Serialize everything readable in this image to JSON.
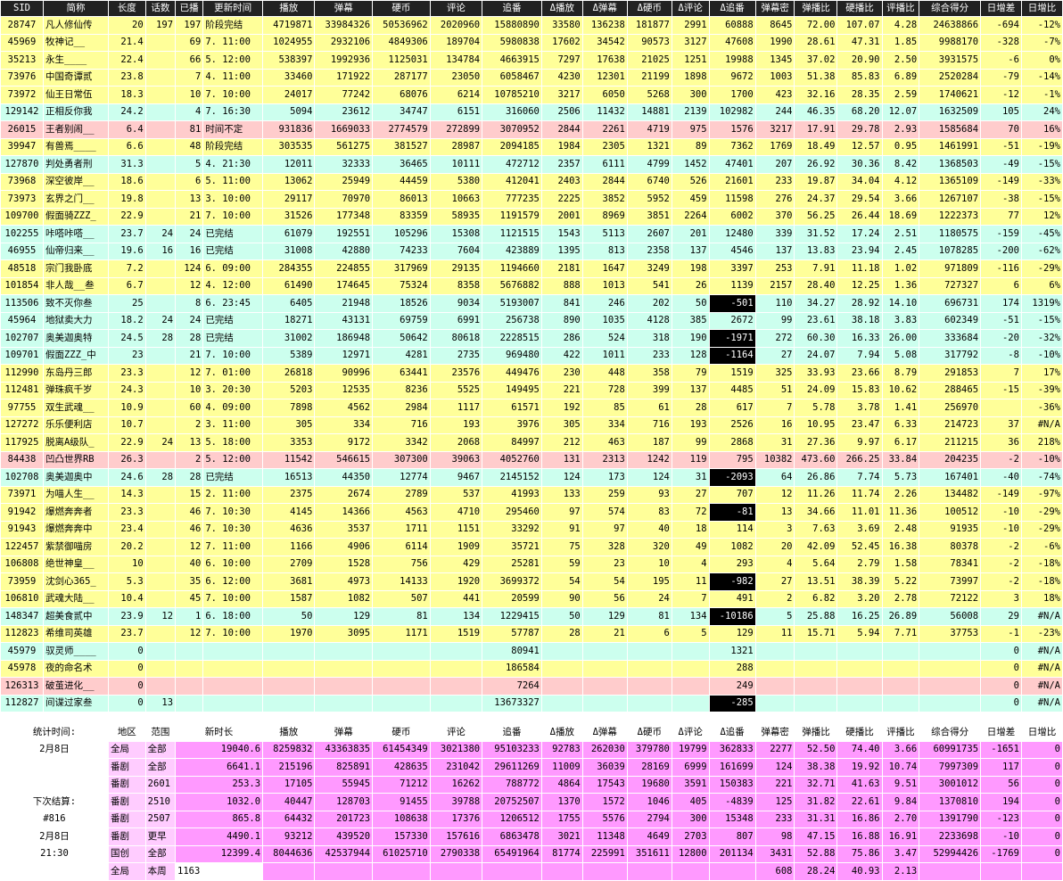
{
  "headers": [
    "SID",
    "简称",
    "长度",
    "话数",
    "已播",
    "更新时间",
    "播放",
    "弹幕",
    "硬币",
    "评论",
    "追番",
    "Δ播放",
    "Δ弹幕",
    "Δ硬币",
    "Δ评论",
    "Δ追番",
    "弹幕密",
    "弹播比",
    "硬播比",
    "评播比",
    "综合得分",
    "日增差",
    "日增比"
  ],
  "rows": [
    {
      "c": "yellow",
      "v": [
        "28747",
        "凡人修仙传",
        "20",
        "197",
        "197",
        "阶段完结",
        "4719871",
        "33984326",
        "50536962",
        "2020960",
        "15880890",
        "33580",
        "136238",
        "181877",
        "2991",
        "60888",
        "8645",
        "72.00",
        "107.07",
        "4.28",
        "24638866",
        "-694",
        "-12%"
      ]
    },
    {
      "c": "yellow",
      "v": [
        "45969",
        "牧神记__",
        "21.4",
        "",
        "69",
        "7. 11:00",
        "1024955",
        "2932106",
        "4849306",
        "189704",
        "5980838",
        "17602",
        "34542",
        "90573",
        "3127",
        "47608",
        "1990",
        "28.61",
        "47.31",
        "1.85",
        "9988170",
        "-328",
        "-7%"
      ]
    },
    {
      "c": "yellow",
      "v": [
        "35213",
        "永生____",
        "22.4",
        "",
        "66",
        "5. 12:00",
        "538397",
        "1992936",
        "1125031",
        "134784",
        "4663915",
        "7297",
        "17638",
        "21025",
        "1251",
        "19988",
        "1345",
        "37.02",
        "20.90",
        "2.50",
        "3931575",
        "-6",
        "0%"
      ]
    },
    {
      "c": "yellow",
      "v": [
        "73976",
        "中国奇谭贰",
        "23.8",
        "",
        "7",
        "4. 11:00",
        "33460",
        "171922",
        "287177",
        "23050",
        "6058467",
        "4230",
        "12301",
        "21199",
        "1898",
        "9672",
        "1003",
        "51.38",
        "85.83",
        "6.89",
        "2520284",
        "-79",
        "-14%"
      ]
    },
    {
      "c": "yellow",
      "v": [
        "73972",
        "仙王日常伍",
        "18.3",
        "",
        "10",
        "7. 10:00",
        "24017",
        "77242",
        "68076",
        "6214",
        "10785210",
        "3217",
        "6050",
        "5268",
        "300",
        "1700",
        "423",
        "32.16",
        "28.35",
        "2.59",
        "1740621",
        "-12",
        "-1%"
      ]
    },
    {
      "c": "cyan",
      "v": [
        "129142",
        "正相反你我",
        "24.2",
        "",
        "4",
        "7. 16:30",
        "5094",
        "23612",
        "34747",
        "6151",
        "316060",
        "2506",
        "11432",
        "14881",
        "2139",
        "102982",
        "244",
        "46.35",
        "68.20",
        "12.07",
        "1632509",
        "105",
        "24%"
      ]
    },
    {
      "c": "pink",
      "v": [
        "26015",
        "王者别闹__",
        "6.4",
        "",
        "81",
        "时间不定",
        "931836",
        "1669033",
        "2774579",
        "272899",
        "3070952",
        "2844",
        "2261",
        "4719",
        "975",
        "1576",
        "3217",
        "17.91",
        "29.78",
        "2.93",
        "1585684",
        "70",
        "16%"
      ]
    },
    {
      "c": "yellow",
      "v": [
        "39947",
        "有兽焉____",
        "6.6",
        "",
        "48",
        "阶段完结",
        "303535",
        "561275",
        "381527",
        "28987",
        "2094185",
        "1984",
        "2305",
        "1321",
        "89",
        "7362",
        "1769",
        "18.49",
        "12.57",
        "0.95",
        "1461991",
        "-51",
        "-19%"
      ]
    },
    {
      "c": "cyan",
      "v": [
        "127870",
        "判处勇者刑",
        "31.3",
        "",
        "5",
        "4. 21:30",
        "12011",
        "32333",
        "36465",
        "10111",
        "472712",
        "2357",
        "6111",
        "4799",
        "1452",
        "47401",
        "207",
        "26.92",
        "30.36",
        "8.42",
        "1368503",
        "-49",
        "-15%"
      ]
    },
    {
      "c": "yellow",
      "v": [
        "73968",
        "深空彼岸__",
        "18.6",
        "",
        "6",
        "5. 11:00",
        "13062",
        "25949",
        "44459",
        "5380",
        "412041",
        "2403",
        "2844",
        "6740",
        "526",
        "21601",
        "233",
        "19.87",
        "34.04",
        "4.12",
        "1365109",
        "-149",
        "-33%"
      ]
    },
    {
      "c": "yellow",
      "v": [
        "73973",
        "玄界之门__",
        "19.8",
        "",
        "13",
        "3. 10:00",
        "29117",
        "70970",
        "86013",
        "10663",
        "777235",
        "2225",
        "3852",
        "5952",
        "459",
        "11598",
        "276",
        "24.37",
        "29.54",
        "3.66",
        "1267107",
        "-38",
        "-15%"
      ]
    },
    {
      "c": "yellow",
      "v": [
        "109700",
        "假面骑ZZZ_",
        "22.9",
        "",
        "21",
        "7. 10:00",
        "31526",
        "177348",
        "83359",
        "58935",
        "1191579",
        "2001",
        "8969",
        "3851",
        "2264",
        "6002",
        "370",
        "56.25",
        "26.44",
        "18.69",
        "1222373",
        "77",
        "12%"
      ]
    },
    {
      "c": "cyan",
      "v": [
        "102255",
        "咔嗒咔嗒__",
        "23.7",
        "24",
        "24",
        "已完结",
        "61079",
        "192551",
        "105296",
        "15308",
        "1121515",
        "1543",
        "5113",
        "2607",
        "201",
        "12480",
        "339",
        "31.52",
        "17.24",
        "2.51",
        "1180575",
        "-159",
        "-45%"
      ]
    },
    {
      "c": "cyan",
      "v": [
        "46955",
        "仙帝归来__",
        "19.6",
        "16",
        "16",
        "已完结",
        "31008",
        "42880",
        "74233",
        "7604",
        "423889",
        "1395",
        "813",
        "2358",
        "137",
        "4546",
        "137",
        "13.83",
        "23.94",
        "2.45",
        "1078285",
        "-200",
        "-62%"
      ]
    },
    {
      "c": "yellow",
      "v": [
        "48518",
        "宗门我卧底",
        "7.2",
        "",
        "124",
        "6. 09:00",
        "284355",
        "224855",
        "317969",
        "29135",
        "1194660",
        "2181",
        "1647",
        "3249",
        "198",
        "3397",
        "253",
        "7.91",
        "11.18",
        "1.02",
        "971809",
        "-116",
        "-29%"
      ]
    },
    {
      "c": "yellow",
      "v": [
        "101854",
        "非人哉__叁",
        "6.7",
        "",
        "12",
        "4. 12:00",
        "61490",
        "174645",
        "75324",
        "8358",
        "5676882",
        "888",
        "1013",
        "541",
        "26",
        "1139",
        "2157",
        "28.40",
        "12.25",
        "1.36",
        "727327",
        "6",
        "6%"
      ]
    },
    {
      "c": "cyan",
      "neg": 15,
      "v": [
        "113506",
        "致不灭你叁",
        "25",
        "",
        "8",
        "6. 23:45",
        "6405",
        "21948",
        "18526",
        "9034",
        "5193007",
        "841",
        "246",
        "202",
        "50",
        "-501",
        "110",
        "34.27",
        "28.92",
        "14.10",
        "696731",
        "174",
        "1319%"
      ]
    },
    {
      "c": "cyan",
      "v": [
        "45964",
        "地狱卖大力",
        "18.2",
        "24",
        "24",
        "已完结",
        "18271",
        "43131",
        "69759",
        "6991",
        "256738",
        "890",
        "1035",
        "4128",
        "385",
        "2672",
        "99",
        "23.61",
        "38.18",
        "3.83",
        "602349",
        "-51",
        "-15%"
      ]
    },
    {
      "c": "cyan",
      "neg": 15,
      "v": [
        "102707",
        "奥美迦奥特",
        "24.5",
        "28",
        "28",
        "已完结",
        "31002",
        "186948",
        "50642",
        "80618",
        "2228515",
        "286",
        "524",
        "318",
        "190",
        "-1971",
        "272",
        "60.30",
        "16.33",
        "26.00",
        "333684",
        "-20",
        "-32%"
      ]
    },
    {
      "c": "cyan",
      "neg": 15,
      "v": [
        "109701",
        "假面ZZZ_中",
        "23",
        "",
        "21",
        "7. 10:00",
        "5389",
        "12971",
        "4281",
        "2735",
        "969480",
        "422",
        "1011",
        "233",
        "128",
        "-1164",
        "27",
        "24.07",
        "7.94",
        "5.08",
        "317792",
        "-8",
        "-10%"
      ]
    },
    {
      "c": "yellow",
      "v": [
        "112990",
        "东岛丹三郎",
        "23.3",
        "",
        "12",
        "7. 01:00",
        "26818",
        "90996",
        "63441",
        "23576",
        "449476",
        "230",
        "448",
        "358",
        "79",
        "1519",
        "325",
        "33.93",
        "23.66",
        "8.79",
        "291853",
        "7",
        "17%"
      ]
    },
    {
      "c": "yellow",
      "v": [
        "112481",
        "弹珠疯千岁",
        "24.3",
        "",
        "10",
        "3. 20:30",
        "5203",
        "12535",
        "8236",
        "5525",
        "149495",
        "221",
        "728",
        "399",
        "137",
        "4485",
        "51",
        "24.09",
        "15.83",
        "10.62",
        "288465",
        "-15",
        "-39%"
      ]
    },
    {
      "c": "yellow",
      "v": [
        "97755",
        "双生武魂__",
        "10.9",
        "",
        "60",
        "4. 09:00",
        "7898",
        "4562",
        "2984",
        "1117",
        "61571",
        "192",
        "85",
        "61",
        "28",
        "617",
        "7",
        "5.78",
        "3.78",
        "1.41",
        "256970",
        "",
        "-36%"
      ]
    },
    {
      "c": "yellow",
      "v": [
        "127272",
        "乐乐便利店",
        "10.7",
        "",
        "2",
        "3. 11:00",
        "305",
        "334",
        "716",
        "193",
        "3976",
        "305",
        "334",
        "716",
        "193",
        "2526",
        "16",
        "10.95",
        "23.47",
        "6.33",
        "214723",
        "37",
        "#N/A"
      ]
    },
    {
      "c": "yellow",
      "v": [
        "117925",
        "脱离A级队_",
        "22.9",
        "24",
        "13",
        "5. 18:00",
        "3353",
        "9172",
        "3342",
        "2068",
        "84997",
        "212",
        "463",
        "187",
        "99",
        "2868",
        "31",
        "27.36",
        "9.97",
        "6.17",
        "211215",
        "36",
        "218%"
      ]
    },
    {
      "c": "pink",
      "v": [
        "84438",
        "凹凸世界RB",
        "26.3",
        "",
        "2",
        "5. 12:00",
        "11542",
        "546615",
        "307300",
        "39063",
        "4052760",
        "131",
        "2313",
        "1242",
        "119",
        "795",
        "10382",
        "473.60",
        "266.25",
        "33.84",
        "204235",
        "-2",
        "-10%"
      ]
    },
    {
      "c": "cyan",
      "neg": 15,
      "v": [
        "102708",
        "奥美迦奥中",
        "24.6",
        "28",
        "28",
        "已完结",
        "16513",
        "44350",
        "12774",
        "9467",
        "2145152",
        "124",
        "173",
        "124",
        "31",
        "-2093",
        "64",
        "26.86",
        "7.74",
        "5.73",
        "167401",
        "-40",
        "-74%"
      ]
    },
    {
      "c": "yellow",
      "v": [
        "73971",
        "为喵人生__",
        "14.3",
        "",
        "15",
        "2. 11:00",
        "2375",
        "2674",
        "2789",
        "537",
        "41993",
        "133",
        "259",
        "93",
        "27",
        "707",
        "12",
        "11.26",
        "11.74",
        "2.26",
        "134482",
        "-149",
        "-97%"
      ]
    },
    {
      "c": "yellow",
      "neg": 15,
      "v": [
        "91942",
        "爆燃奔奔者",
        "23.3",
        "",
        "46",
        "7. 10:30",
        "4145",
        "14366",
        "4563",
        "4710",
        "295460",
        "97",
        "574",
        "83",
        "72",
        "-81",
        "13",
        "34.66",
        "11.01",
        "11.36",
        "100512",
        "-10",
        "-29%"
      ]
    },
    {
      "c": "yellow",
      "v": [
        "91943",
        "爆燃奔奔中",
        "23.4",
        "",
        "46",
        "7. 10:30",
        "4636",
        "3537",
        "1711",
        "1151",
        "33292",
        "91",
        "97",
        "40",
        "18",
        "114",
        "3",
        "7.63",
        "3.69",
        "2.48",
        "91935",
        "-10",
        "-29%"
      ]
    },
    {
      "c": "yellow",
      "v": [
        "122457",
        "紫禁御喵房",
        "20.2",
        "",
        "12",
        "7. 11:00",
        "1166",
        "4906",
        "6114",
        "1909",
        "35721",
        "75",
        "328",
        "320",
        "49",
        "1082",
        "20",
        "42.09",
        "52.45",
        "16.38",
        "80378",
        "-2",
        "-6%"
      ]
    },
    {
      "c": "yellow",
      "v": [
        "106808",
        "绝世神皇__",
        "10",
        "",
        "40",
        "6. 10:00",
        "2709",
        "1528",
        "756",
        "429",
        "25281",
        "59",
        "23",
        "10",
        "4",
        "293",
        "4",
        "5.64",
        "2.79",
        "1.58",
        "78341",
        "-2",
        "-18%"
      ]
    },
    {
      "c": "yellow",
      "neg": 15,
      "v": [
        "73959",
        "沈剑心365_",
        "5.3",
        "",
        "35",
        "6. 12:00",
        "3681",
        "4973",
        "14133",
        "1920",
        "3699372",
        "54",
        "54",
        "195",
        "11",
        "-982",
        "27",
        "13.51",
        "38.39",
        "5.22",
        "73997",
        "-2",
        "-18%"
      ]
    },
    {
      "c": "yellow",
      "v": [
        "106810",
        "武魂大陆__",
        "10.4",
        "",
        "45",
        "7. 10:00",
        "1587",
        "1082",
        "507",
        "441",
        "20599",
        "90",
        "56",
        "24",
        "7",
        "491",
        "2",
        "6.82",
        "3.20",
        "2.78",
        "72122",
        "3",
        "18%"
      ]
    },
    {
      "c": "cyan",
      "neg": 15,
      "v": [
        "148347",
        "超美食贰中",
        "23.9",
        "12",
        "1",
        "6. 18:00",
        "50",
        "129",
        "81",
        "134",
        "1229415",
        "50",
        "129",
        "81",
        "134",
        "-10186",
        "5",
        "25.88",
        "16.25",
        "26.89",
        "56008",
        "29",
        "#N/A"
      ]
    },
    {
      "c": "yellow",
      "v": [
        "112823",
        "希维司英雄",
        "23.7",
        "",
        "12",
        "7. 10:00",
        "1970",
        "3095",
        "1171",
        "1519",
        "57787",
        "28",
        "21",
        "6",
        "5",
        "129",
        "11",
        "15.71",
        "5.94",
        "7.71",
        "37753",
        "-1",
        "-23%"
      ]
    },
    {
      "c": "cyan",
      "v": [
        "45979",
        "驭灵师____",
        "0",
        "",
        "",
        "",
        "",
        "",
        "",
        "",
        "80941",
        "",
        "",
        "",
        "",
        "1321",
        "",
        "",
        "",
        "",
        "",
        "0",
        "#N/A"
      ]
    },
    {
      "c": "yellow",
      "v": [
        "45978",
        "夜的命名术",
        "0",
        "",
        "",
        "",
        "",
        "",
        "",
        "",
        "186584",
        "",
        "",
        "",
        "",
        "288",
        "",
        "",
        "",
        "",
        "",
        "0",
        "#N/A"
      ]
    },
    {
      "c": "pink",
      "v": [
        "126313",
        "破茧进化__",
        "0",
        "",
        "",
        "",
        "",
        "",
        "",
        "",
        "7264",
        "",
        "",
        "",
        "",
        "249",
        "",
        "",
        "",
        "",
        "",
        "0",
        "#N/A"
      ]
    },
    {
      "c": "cyan",
      "neg": 15,
      "v": [
        "112827",
        "间谍过家叁",
        "0",
        "13",
        "",
        "",
        "",
        "",
        "",
        "",
        "13673327",
        "",
        "",
        "",
        "",
        "-285",
        "",
        "",
        "",
        "",
        "",
        "0",
        "#N/A"
      ]
    }
  ],
  "stats_header": [
    "统计时间:",
    "地区",
    "范围",
    "新时长",
    "播放",
    "弹幕",
    "硬币",
    "评论",
    "追番",
    "Δ播放",
    "Δ弹幕",
    "Δ硬币",
    "Δ评论",
    "Δ追番",
    "弹幕密",
    "弹播比",
    "硬播比",
    "评播比",
    "综合得分",
    "日增差",
    "日增比"
  ],
  "stats": [
    [
      "2月8日",
      "全局",
      "全部",
      "19040.6",
      "8259832",
      "43363835",
      "61454349",
      "3021380",
      "95103233",
      "92783",
      "262030",
      "379780",
      "19799",
      "362833",
      "2277",
      "52.50",
      "74.40",
      "3.66",
      "60991735",
      "-1651",
      "0"
    ],
    [
      "",
      "番剧",
      "全部",
      "6641.1",
      "215196",
      "825891",
      "428635",
      "231042",
      "29611269",
      "11009",
      "36039",
      "28169",
      "6999",
      "161699",
      "124",
      "38.38",
      "19.92",
      "10.74",
      "7997309",
      "117",
      "0"
    ],
    [
      "",
      "番剧",
      "2601",
      "253.3",
      "17105",
      "55945",
      "71212",
      "16262",
      "788772",
      "4864",
      "17543",
      "19680",
      "3591",
      "150383",
      "221",
      "32.71",
      "41.63",
      "9.51",
      "3001012",
      "56",
      "0"
    ],
    [
      "下次结算:",
      "番剧",
      "2510",
      "1032.0",
      "40447",
      "128703",
      "91455",
      "39788",
      "20752507",
      "1370",
      "1572",
      "1046",
      "405",
      "-4839",
      "125",
      "31.82",
      "22.61",
      "9.84",
      "1370810",
      "194",
      "0"
    ],
    [
      "#816",
      "番剧",
      "2507",
      "865.8",
      "64432",
      "201723",
      "108638",
      "17376",
      "1206512",
      "1755",
      "5576",
      "2794",
      "300",
      "15348",
      "233",
      "31.31",
      "16.86",
      "2.70",
      "1391790",
      "-123",
      "0"
    ],
    [
      "2月8日",
      "番剧",
      "更早",
      "4490.1",
      "93212",
      "439520",
      "157330",
      "157616",
      "6863478",
      "3021",
      "11348",
      "4649",
      "2703",
      "807",
      "98",
      "47.15",
      "16.88",
      "16.91",
      "2233698",
      "-10",
      "0"
    ],
    [
      "21:30",
      "国创",
      "全部",
      "12399.4",
      "8044636",
      "42537944",
      "61025710",
      "2790338",
      "65491964",
      "81774",
      "225991",
      "351611",
      "12800",
      "201134",
      "3431",
      "52.88",
      "75.86",
      "3.47",
      "52994426",
      "-1769",
      "0"
    ],
    [
      "",
      "全局",
      "本周",
      "1163",
      "",
      "",
      "",
      "",
      "",
      "",
      "",
      "",
      "",
      "",
      "608",
      "28.24",
      "40.93",
      "2.13",
      "",
      "",
      ""
    ]
  ]
}
